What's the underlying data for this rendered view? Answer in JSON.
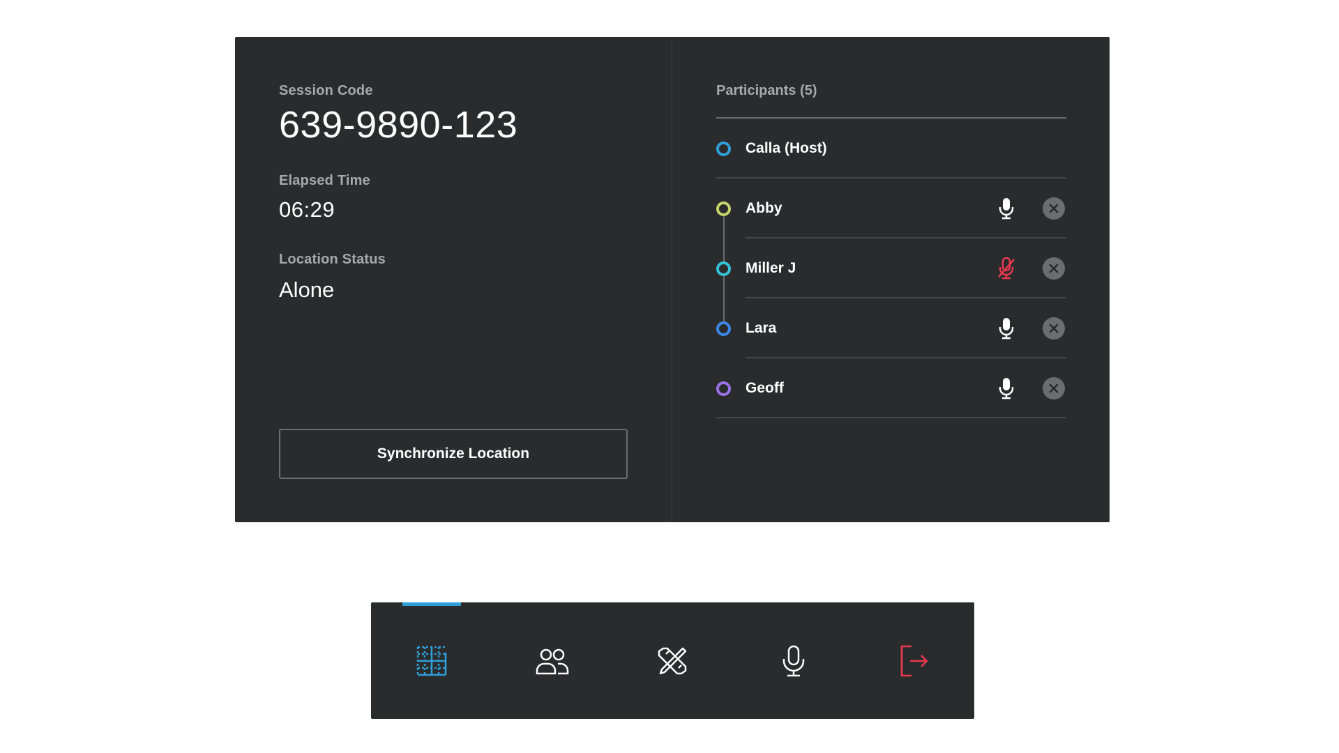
{
  "session": {
    "code_label": "Session Code",
    "code": "639-9890-123",
    "elapsed_label": "Elapsed Time",
    "elapsed": "06:29",
    "location_label": "Location Status",
    "location": "Alone",
    "sync_button": "Synchronize Location"
  },
  "participants": {
    "title": "Participants (5)",
    "items": [
      {
        "name": "Calla (Host)",
        "color": "#2f9fd8",
        "mic": "none"
      },
      {
        "name": "Abby",
        "color": "#c6d46a",
        "mic": "on"
      },
      {
        "name": "Miller J",
        "color": "#36c2d6",
        "mic": "muted"
      },
      {
        "name": "Lara",
        "color": "#3b86e8",
        "mic": "on"
      },
      {
        "name": "Geoff",
        "color": "#9a73e8",
        "mic": "on"
      }
    ]
  },
  "toolbar": {
    "items": [
      {
        "icon": "grid-icon",
        "active": true,
        "color": "#2f9fd8"
      },
      {
        "icon": "people-icon",
        "active": false,
        "color": "#ffffff"
      },
      {
        "icon": "tools-icon",
        "active": false,
        "color": "#ffffff"
      },
      {
        "icon": "microphone-icon",
        "active": false,
        "color": "#ffffff"
      },
      {
        "icon": "exit-icon",
        "active": false,
        "color": "#e8394f"
      }
    ]
  },
  "colors": {
    "panel": "#2a2b2d",
    "accent": "#2f9fd8",
    "muted": "#e8394f",
    "divider": "#45464a"
  }
}
